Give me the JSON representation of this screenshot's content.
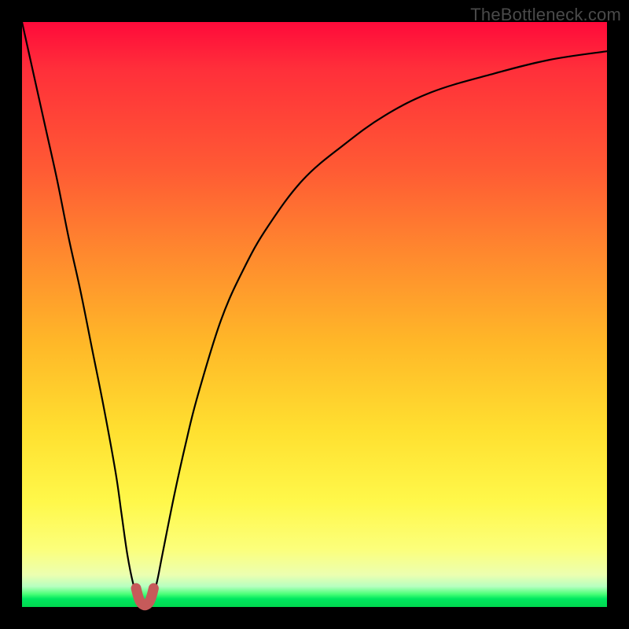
{
  "watermark": {
    "text": "TheBottleneck.com"
  },
  "colors": {
    "frame": "#000000",
    "curve_stroke": "#000000",
    "marker_fill": "#c65a5a",
    "marker_stroke": "#c65a5a"
  },
  "chart_data": {
    "type": "line",
    "title": "",
    "xlabel": "",
    "ylabel": "",
    "xlim": [
      0,
      100
    ],
    "ylim": [
      0,
      100
    ],
    "grid": false,
    "legend": false,
    "series": [
      {
        "name": "bottleneck-curve",
        "x": [
          0,
          2,
          4,
          6,
          8,
          10,
          12,
          14,
          16,
          17,
          18,
          19,
          20,
          21,
          22,
          23,
          24,
          26,
          28,
          30,
          34,
          38,
          42,
          48,
          55,
          62,
          70,
          80,
          90,
          100
        ],
        "y": [
          100,
          91,
          82,
          73,
          63,
          54,
          44,
          34,
          23,
          16,
          9,
          4,
          1,
          0.3,
          1,
          4,
          9,
          19,
          28,
          36,
          49,
          58,
          65,
          73,
          79,
          84,
          88,
          91,
          93.5,
          95
        ]
      }
    ],
    "marker": {
      "name": "optimal-U",
      "x_center": 21,
      "x": [
        19.5,
        19.9,
        20.3,
        20.8,
        21.2,
        21.7,
        22.1,
        22.5
      ],
      "y": [
        3.2,
        1.6,
        0.7,
        0.3,
        0.3,
        0.7,
        1.6,
        3.2
      ]
    }
  }
}
